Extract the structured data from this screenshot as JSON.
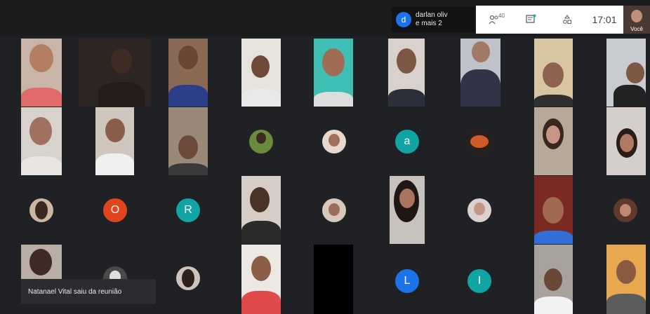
{
  "presenter": {
    "initial": "d",
    "name_line1": "darlan oliv",
    "name_line2": "e mais 2"
  },
  "toolbar": {
    "participants_count": "40",
    "clock": "17:01"
  },
  "self_view": {
    "label": "Você"
  },
  "letter_avatars": [
    {
      "letter": "a",
      "color": "#12a4a4"
    },
    {
      "letter": "O",
      "color": "#e0451f"
    },
    {
      "letter": "R",
      "color": "#12a4a4"
    },
    {
      "letter": "L",
      "color": "#1a73e8"
    },
    {
      "letter": "I",
      "color": "#12a4a4"
    }
  ],
  "notification": {
    "text": "Natanael Vital saiu da reunião"
  }
}
